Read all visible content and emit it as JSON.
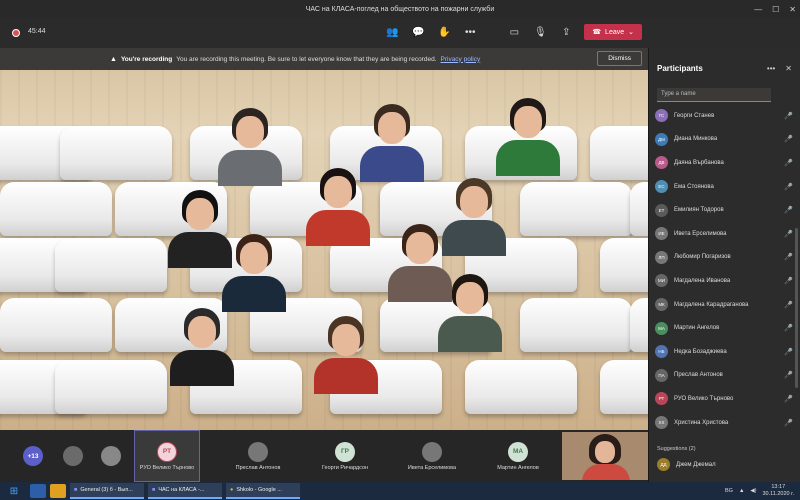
{
  "window": {
    "title": "ЧАС на КЛАСА-поглед на обществото на пожарни служби",
    "controls": [
      "—",
      "☐",
      "✕"
    ]
  },
  "toolbar": {
    "timer": "45:44",
    "leave_label": "Leave",
    "icons": [
      "participants-icon",
      "chat-icon",
      "raise-hand-icon",
      "more-icon",
      "camera-icon",
      "mic-icon",
      "share-icon"
    ]
  },
  "banner": {
    "title": "You're recording",
    "text": "You are recording this meeting. Be sure to let everyone know that they are being recorded.",
    "link": "Privacy policy",
    "dismiss": "Dismiss"
  },
  "panel": {
    "title": "Participants",
    "search_placeholder": "Type a name",
    "participants": [
      {
        "name": "Георги Станев",
        "initials": "ГС",
        "color": "#8b6fb8"
      },
      {
        "name": "Диана Минкова",
        "initials": "ДМ",
        "color": "#3d7ab8"
      },
      {
        "name": "Даяна Върбанова",
        "initials": "ДВ",
        "color": "#b85a8a"
      },
      {
        "name": "Ема Стоянова",
        "initials": "ЕС",
        "color": "#4f8fb3"
      },
      {
        "name": "Емилиян Тодоров",
        "initials": "ЕТ",
        "color": "#5a5a5a"
      },
      {
        "name": "Ивета Ерселимова",
        "initials": "ИЕ",
        "color": "#777777"
      },
      {
        "name": "Любомир Погаризов",
        "initials": "ЛП",
        "color": "#777777"
      },
      {
        "name": "Магдалена Иванова",
        "initials": "МИ",
        "color": "#666666"
      },
      {
        "name": "Магдалена Карадраганова",
        "initials": "МК",
        "color": "#666666"
      },
      {
        "name": "Мартин Ангелов",
        "initials": "МА",
        "color": "#4b8f5f"
      },
      {
        "name": "Недка Бозаджиева",
        "initials": "НБ",
        "color": "#4f73b3"
      },
      {
        "name": "Преслав Антонов",
        "initials": "ПА",
        "color": "#666666"
      },
      {
        "name": "РУО Велико Търново",
        "initials": "РТ",
        "color": "#b8475a"
      },
      {
        "name": "Христина Христова",
        "initials": "ХХ",
        "color": "#777777"
      }
    ],
    "suggestions_label": "Suggestions (2)",
    "suggestion": {
      "name": "Джем Джемал",
      "initials": "ДД",
      "color": "#9c7d2b"
    }
  },
  "strip": {
    "overflow": "+13",
    "tiles": [
      {
        "name": "РУО Велико Търново",
        "initials": "РТ",
        "color": "#f2d3da",
        "fg": "#b8475a"
      },
      {
        "name": "Преслав Антонов",
        "initials": "",
        "color": "#777"
      },
      {
        "name": "Георги Ричардсон",
        "initials": "ГР",
        "color": "#cfe2d4",
        "fg": "#3f7a4f"
      },
      {
        "name": "Ивета Ерселимова",
        "initials": "",
        "color": "#777"
      },
      {
        "name": "Мартин Ангелов",
        "initials": "МА",
        "color": "#cfe2d4",
        "fg": "#3f7a4f"
      }
    ]
  },
  "taskbar": {
    "items": [
      "General (3) б - Вып...",
      "ЧАС на КЛАСА -...",
      "Shkolo - Google ..."
    ],
    "lang": "BG",
    "time": "13:17",
    "date": "30.11.2020 г."
  }
}
